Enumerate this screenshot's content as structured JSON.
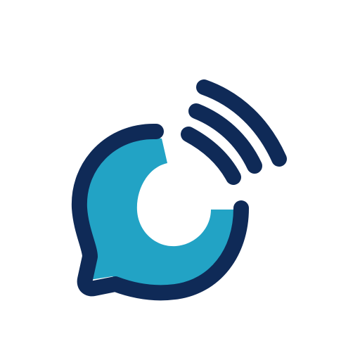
{
  "colors": {
    "background": "#ffffff",
    "navy": "#0f2a57",
    "cyan": "#22a3c5"
  },
  "icon": {
    "logo": "chat-bubble-signal-icon",
    "bubble": "chat-bubble-icon",
    "waves": "signal-waves-icon"
  }
}
